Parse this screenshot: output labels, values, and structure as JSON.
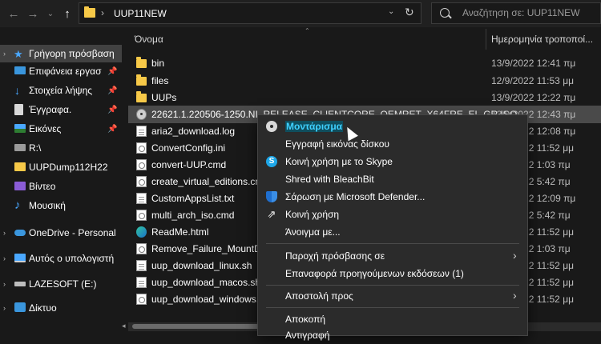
{
  "toolbar": {
    "back_icon": "arrow-left-icon",
    "forward_icon": "arrow-right-icon",
    "recent_icon": "chevron-down-icon",
    "up_icon": "arrow-up-icon"
  },
  "address": {
    "separator": "›",
    "path": "UUP11NEW",
    "dropdown": "⌄",
    "refresh": "↻"
  },
  "search": {
    "placeholder": "Αναζήτηση σε: UUP11NEW"
  },
  "sidebar": {
    "items": [
      {
        "label": "Γρήγορη πρόσβαση",
        "icon": "star-icon"
      },
      {
        "label": "Επιφάνεια εργασ",
        "icon": "desktop-icon"
      },
      {
        "label": "Στοιχεία λήψης",
        "icon": "download-icon"
      },
      {
        "label": "Έγγραφα.",
        "icon": "documents-icon"
      },
      {
        "label": "Εικόνες",
        "icon": "pictures-icon"
      },
      {
        "label": "R:\\",
        "icon": "drive-icon"
      },
      {
        "label": "UUPDump112H22",
        "icon": "folder-icon"
      },
      {
        "label": "Βίντεο",
        "icon": "video-icon"
      },
      {
        "label": "Μουσική",
        "icon": "music-icon"
      },
      {
        "label": "OneDrive - Personal",
        "icon": "cloud-icon"
      },
      {
        "label": "Αυτός ο υπολογιστή",
        "icon": "computer-icon"
      },
      {
        "label": "LAZESOFT (E:)",
        "icon": "usb-drive-icon"
      },
      {
        "label": "Δίκτυο",
        "icon": "network-icon"
      }
    ],
    "pin_glyph": "📌"
  },
  "columns": {
    "name": "Όνομα",
    "date": "Ημερομηνία τροποποί..."
  },
  "files": [
    {
      "name": "bin",
      "date": "13/9/2022 12:41 πμ",
      "icon": "folder"
    },
    {
      "name": "files",
      "date": "12/9/2022 11:53 μμ",
      "icon": "folder"
    },
    {
      "name": "UUPs",
      "date": "13/9/2022 12:22 πμ",
      "icon": "folder"
    },
    {
      "name": "22621.1.220506-1250.NI_RELEASE_CLIENTCORE_OEMRET_X64FRE_EL-GR.ISO",
      "date": "13/9/2022 12:43 πμ",
      "icon": "disc"
    },
    {
      "name": "aria2_download.log",
      "date": "13/9/2022 12:08 πμ",
      "icon": "doc"
    },
    {
      "name": "ConvertConfig.ini",
      "date": "12/9/2022 11:52 μμ",
      "icon": "gear"
    },
    {
      "name": "convert-UUP.cmd",
      "date": "13/9/2022 1:03 πμ",
      "icon": "gear"
    },
    {
      "name": "create_virtual_editions.cmd",
      "date": "15/8/2022 5:42 πμ",
      "icon": "gear"
    },
    {
      "name": "CustomAppsList.txt",
      "date": "13/9/2022 12:09 πμ",
      "icon": "doc"
    },
    {
      "name": "multi_arch_iso.cmd",
      "date": "15/8/2022 5:42 πμ",
      "icon": "gear"
    },
    {
      "name": "ReadMe.html",
      "date": "12/9/2022 11:52 μμ",
      "icon": "edge"
    },
    {
      "name": "Remove_Failure_MountDir.cmd",
      "date": "13/9/2022 1:03 πμ",
      "icon": "gear"
    },
    {
      "name": "uup_download_linux.sh",
      "date": "12/9/2022 11:52 μμ",
      "icon": "doc"
    },
    {
      "name": "uup_download_macos.sh",
      "date": "12/9/2022 11:52 μμ",
      "icon": "doc"
    },
    {
      "name": "uup_download_windows.cmd",
      "date": "12/9/2022 11:52 μμ",
      "icon": "gear"
    }
  ],
  "context_menu": {
    "items": [
      {
        "label": "Μοντάρισμα",
        "icon": "disc-icon",
        "submenu": false,
        "default": true
      },
      {
        "label": "Εγγραφή εικόνας δίσκου",
        "icon": "",
        "submenu": false
      },
      {
        "label": "Κοινή χρήση με το Skype",
        "icon": "skype-icon",
        "submenu": false
      },
      {
        "label": "Shred with BleachBit",
        "icon": "",
        "submenu": false
      },
      {
        "label": "Σάρωση με Microsoft Defender...",
        "icon": "defender-shield-icon",
        "submenu": false
      },
      {
        "label": "Κοινή χρήση",
        "icon": "share-icon",
        "submenu": false
      },
      {
        "label": "Άνοιγμα με...",
        "icon": "",
        "submenu": false
      },
      {
        "label": "Παροχή πρόσβασης σε",
        "icon": "",
        "submenu": true
      },
      {
        "label": "Επαναφορά προηγούμενων εκδόσεων (1)",
        "icon": "",
        "submenu": false
      },
      {
        "label": "Αποστολή προς",
        "icon": "",
        "submenu": true
      },
      {
        "label": "Αποκοπή",
        "icon": "",
        "submenu": false
      },
      {
        "label": "Αντιγραφή",
        "icon": "",
        "submenu": false
      }
    ],
    "submenu_glyph": "›",
    "skype_glyph": "S",
    "share_glyph": "⇗"
  }
}
